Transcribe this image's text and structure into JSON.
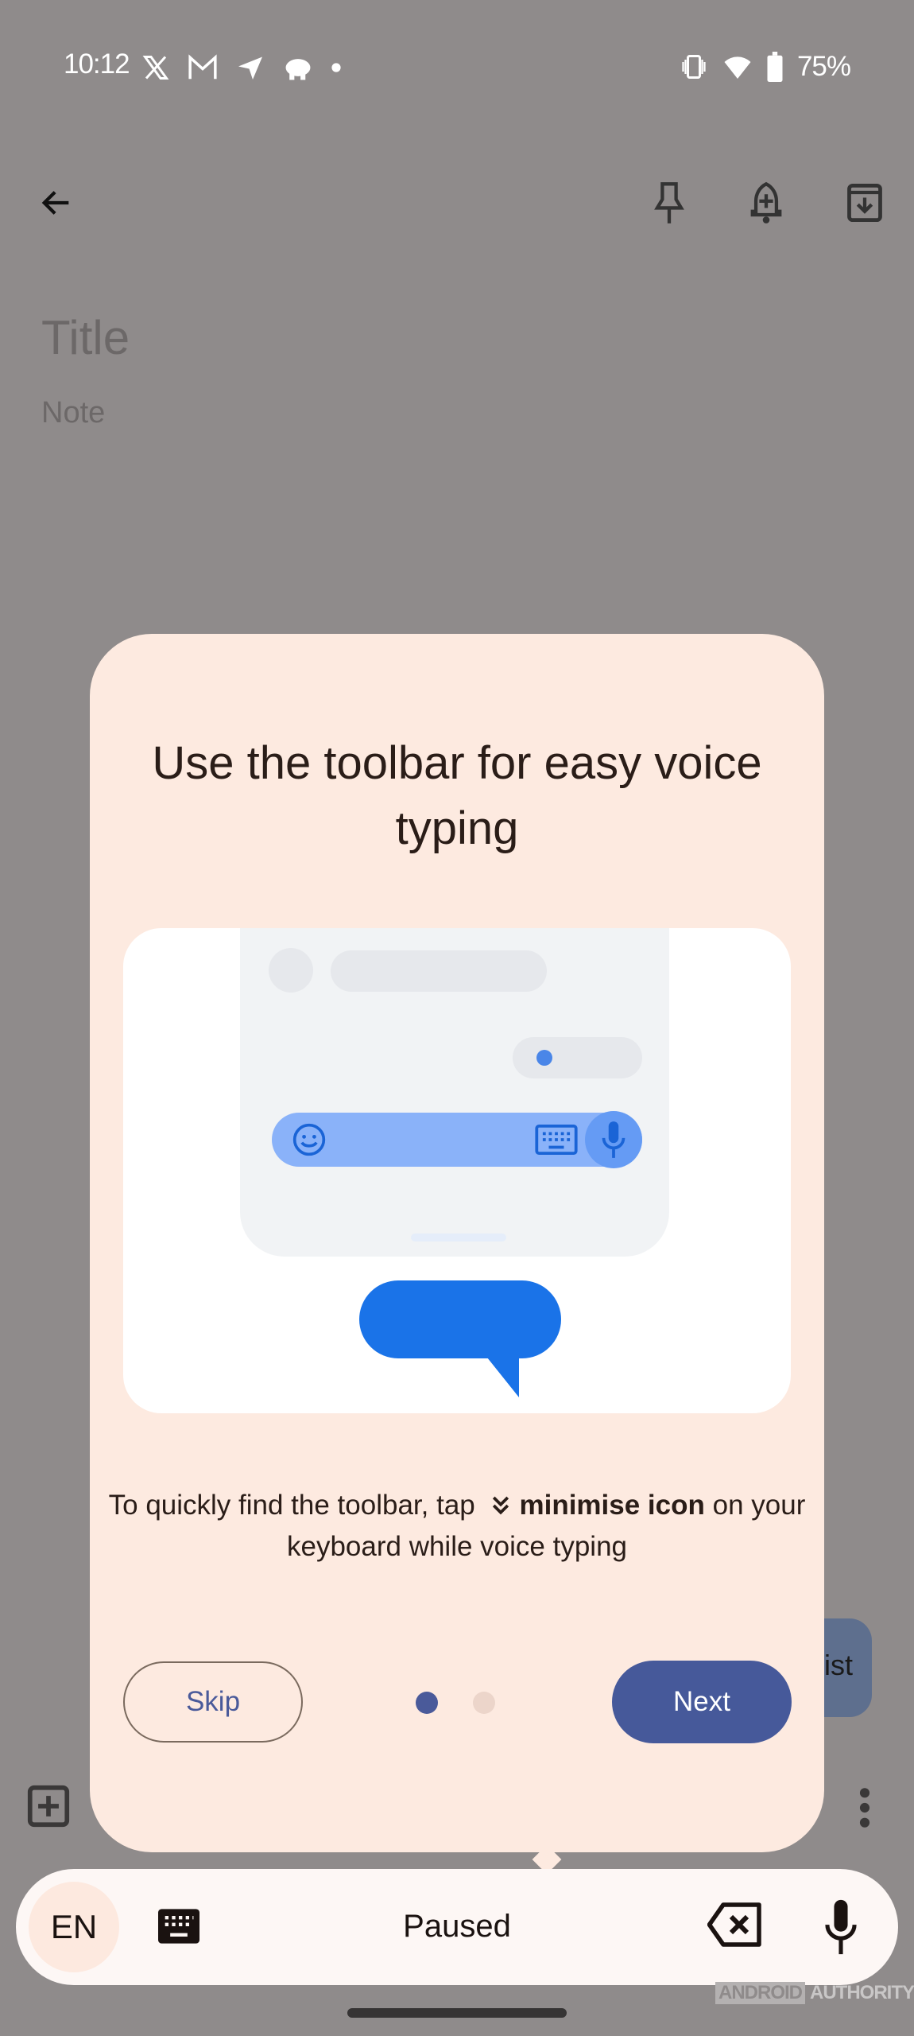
{
  "status_bar": {
    "time": "10:12",
    "left_icons": [
      "x-icon",
      "gmail-icon",
      "telegram-icon",
      "piggy-bank-icon",
      "notification-dot-icon"
    ],
    "right_icons": [
      "vibrate-icon",
      "wifi-icon",
      "battery-icon"
    ],
    "battery": "75%"
  },
  "app_bar": {
    "back": "back-arrow-icon",
    "actions": [
      "pin-icon",
      "reminder-icon",
      "archive-icon"
    ]
  },
  "note": {
    "title_placeholder": "Title",
    "body_placeholder": "Note"
  },
  "background": {
    "chip_partial_label": "ist"
  },
  "dialog": {
    "title": "Use the toolbar for easy voice typing",
    "description_prefix": "To quickly find the toolbar, tap",
    "description_icon": "minimise-chevrons-icon",
    "description_bold": "minimise icon",
    "description_suffix": "on your keyboard while voice typing",
    "skip_label": "Skip",
    "next_label": "Next",
    "pager": {
      "current": 1,
      "total": 2
    }
  },
  "voice_toolbar": {
    "language": "EN",
    "status": "Paused"
  },
  "watermark": {
    "part1": "ANDROID",
    "part2": "AUTHORITY"
  },
  "colors": {
    "scrim": "#8f8b8b",
    "dialog_bg": "#fdeae0",
    "primary": "#46599a",
    "illustration_blue": "#1a73e8"
  }
}
